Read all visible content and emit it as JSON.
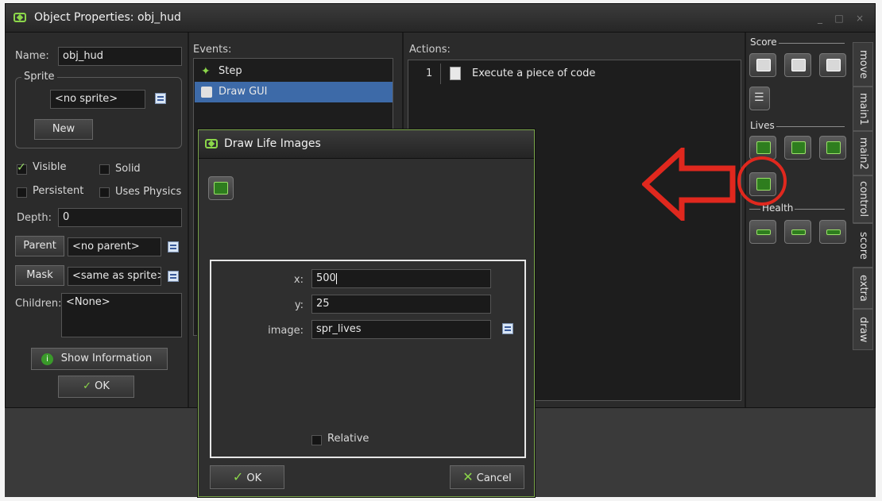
{
  "window": {
    "title": "Object Properties: obj_hud"
  },
  "properties": {
    "name_label": "Name:",
    "name_value": "obj_hud",
    "sprite_group": "Sprite",
    "sprite_value": "<no sprite>",
    "new_button": "New",
    "visible_label": "Visible",
    "solid_label": "Solid",
    "persistent_label": "Persistent",
    "physics_label": "Uses Physics",
    "depth_label": "Depth:",
    "depth_value": "0",
    "parent_button": "Parent",
    "parent_value": "<no parent>",
    "mask_button": "Mask",
    "mask_value": "<same as sprite>",
    "children_label": "Children:",
    "children_value": "<None>",
    "show_info_button": "Show Information",
    "ok_button": "OK"
  },
  "events": {
    "label": "Events:",
    "items": [
      {
        "label": "Step",
        "selected": false
      },
      {
        "label": "Draw GUI",
        "selected": true
      }
    ]
  },
  "actions": {
    "label": "Actions:",
    "items": [
      {
        "number": "1",
        "label": "Execute a piece of code"
      }
    ]
  },
  "library": {
    "score_title": "Score",
    "lives_title": "Lives",
    "health_title": "Health",
    "tabs": [
      "move",
      "main1",
      "main2",
      "control",
      "score",
      "extra",
      "draw"
    ],
    "active_tab": "score"
  },
  "dialog": {
    "title": "Draw Life Images",
    "x_label": "x:",
    "x_value": "500",
    "y_label": "y:",
    "y_value": "25",
    "image_label": "image:",
    "image_value": "spr_lives",
    "relative_label": "Relative",
    "ok_button": "OK",
    "cancel_button": "Cancel"
  },
  "colors": {
    "accent_green": "#8bd64a",
    "selection_blue": "#3d6aa8",
    "annotation_red": "#e0281e"
  }
}
